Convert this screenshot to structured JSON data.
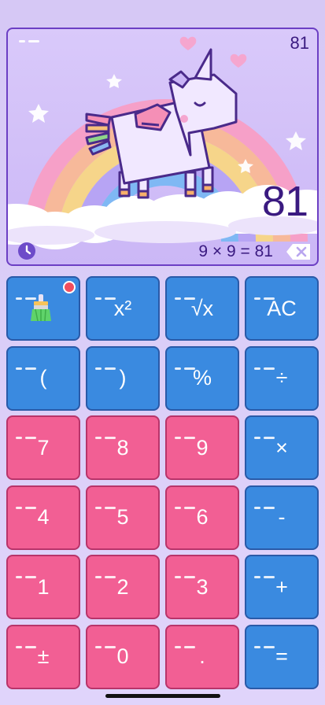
{
  "display": {
    "small_result": "81",
    "big_result": "81",
    "expression": "9 × 9 = 81",
    "history_icon": "clock-icon",
    "backspace_icon": "backspace-icon",
    "art": "unicorn-rainbow-illustration"
  },
  "colors": {
    "blue_key": "#3a8ae0",
    "pink_key": "#f25f94",
    "text_dark": "#3a1a80",
    "badge": "#f04e5e"
  },
  "keys": {
    "theme": {
      "icon": "paint-brush-icon",
      "badge": true
    },
    "square": "x²",
    "sqrt": "√x",
    "clear": "AC",
    "paren_open": "(",
    "paren_close": ")",
    "percent": "%",
    "divide": "÷",
    "seven": "7",
    "eight": "8",
    "nine": "9",
    "multiply": "×",
    "four": "4",
    "five": "5",
    "six": "6",
    "minus": "-",
    "one": "1",
    "two": "2",
    "three": "3",
    "plus": "+",
    "plus_minus": "±",
    "zero": "0",
    "decimal": ".",
    "equals": "="
  }
}
